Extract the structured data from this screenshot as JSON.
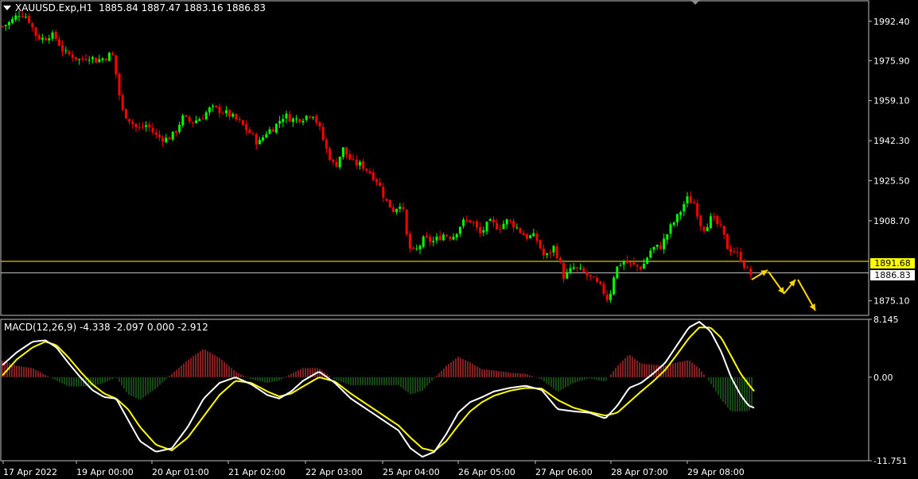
{
  "header": {
    "symbol": "XAUUSD.Exp,H1",
    "ohlc": "1885.84 1887.47 1883.16 1886.83"
  },
  "macd_label": "MACD(12,26,9) -4.338 -2.097 0.000 -2.912",
  "price_axis": {
    "ticks": [
      "1992.40",
      "1975.90",
      "1959.10",
      "1942.30",
      "1925.50",
      "1908.70",
      "1875.10"
    ],
    "tick_values": [
      1992.4,
      1975.9,
      1959.1,
      1942.3,
      1925.5,
      1908.7,
      1875.1
    ],
    "level_label": "1891.68",
    "bid_label": "1886.83"
  },
  "macd_axis": {
    "ticks": [
      "8.145",
      "0.00",
      "-11.751"
    ],
    "tick_values": [
      8.145,
      0.0,
      -11.751
    ]
  },
  "time_axis": {
    "labels": [
      "17 Apr 2022",
      "19 Apr 00:00",
      "20 Apr 01:00",
      "21 Apr 02:00",
      "22 Apr 03:00",
      "25 Apr 04:00",
      "26 Apr 05:00",
      "27 Apr 06:00",
      "28 Apr 07:00",
      "29 Apr 08:00"
    ]
  },
  "colors": {
    "background": "#000000",
    "bull": "#00ff00",
    "bear": "#ff0000",
    "level": "#ffff00",
    "bid": "#c0c0c0",
    "macd_main": "#ffffff",
    "macd_signal": "#ffff00",
    "hist_pos": "#ff4040",
    "hist_neg": "#2e8b2e",
    "arrows": "#ffd700"
  },
  "chart_data": [
    {
      "type": "candlestick",
      "symbol": "XAUUSD.Exp",
      "timeframe": "H1",
      "ylim": [
        1869.0,
        2001.0
      ],
      "level_line": 1891.68,
      "bid_line": 1886.83,
      "close_path": [
        [
          0,
          1990
        ],
        [
          12,
          1992
        ],
        [
          24,
          1996
        ],
        [
          34,
          1994
        ],
        [
          45,
          1986
        ],
        [
          54,
          1985
        ],
        [
          62,
          1987
        ],
        [
          70,
          1985
        ],
        [
          80,
          1979
        ],
        [
          90,
          1978
        ],
        [
          100,
          1976
        ],
        [
          110,
          1978
        ],
        [
          120,
          1976
        ],
        [
          130,
          1977
        ],
        [
          140,
          1979
        ],
        [
          146,
          1968
        ],
        [
          152,
          1955
        ],
        [
          160,
          1952
        ],
        [
          172,
          1947
        ],
        [
          184,
          1949
        ],
        [
          196,
          1944
        ],
        [
          208,
          1943
        ],
        [
          218,
          1945
        ],
        [
          228,
          1952
        ],
        [
          240,
          1950
        ],
        [
          252,
          1952
        ],
        [
          264,
          1956
        ],
        [
          276,
          1955
        ],
        [
          288,
          1953
        ],
        [
          300,
          1950
        ],
        [
          312,
          1946
        ],
        [
          324,
          1941
        ],
        [
          334,
          1946
        ],
        [
          344,
          1948
        ],
        [
          356,
          1953
        ],
        [
          368,
          1951
        ],
        [
          380,
          1952
        ],
        [
          392,
          1954
        ],
        [
          400,
          1948
        ],
        [
          410,
          1938
        ],
        [
          420,
          1931
        ],
        [
          430,
          1939
        ],
        [
          442,
          1933
        ],
        [
          454,
          1932
        ],
        [
          464,
          1929
        ],
        [
          474,
          1925
        ],
        [
          484,
          1917
        ],
        [
          494,
          1913
        ],
        [
          504,
          1917
        ],
        [
          512,
          1898
        ],
        [
          520,
          1895
        ],
        [
          532,
          1901
        ],
        [
          544,
          1900
        ],
        [
          556,
          1903
        ],
        [
          568,
          1902
        ],
        [
          580,
          1908
        ],
        [
          592,
          1909
        ],
        [
          602,
          1903
        ],
        [
          614,
          1908
        ],
        [
          626,
          1906
        ],
        [
          638,
          1909
        ],
        [
          648,
          1906
        ],
        [
          660,
          1902
        ],
        [
          672,
          1902
        ],
        [
          684,
          1893
        ],
        [
          696,
          1898
        ],
        [
          708,
          1885
        ],
        [
          720,
          1889
        ],
        [
          732,
          1887
        ],
        [
          744,
          1884
        ],
        [
          756,
          1880
        ],
        [
          764,
          1875
        ],
        [
          772,
          1888
        ],
        [
          782,
          1892
        ],
        [
          794,
          1890
        ],
        [
          806,
          1889
        ],
        [
          818,
          1897
        ],
        [
          830,
          1898
        ],
        [
          842,
          1906
        ],
        [
          852,
          1911
        ],
        [
          862,
          1918
        ],
        [
          872,
          1916
        ],
        [
          882,
          1905
        ],
        [
          894,
          1910
        ],
        [
          906,
          1905
        ],
        [
          914,
          1897
        ],
        [
          922,
          1896
        ],
        [
          930,
          1893
        ],
        [
          938,
          1888
        ],
        [
          946,
          1885
        ]
      ]
    },
    {
      "type": "line",
      "indicator": "MACD(12,26,9)",
      "ylim": [
        -11.751,
        8.145
      ],
      "series": [
        {
          "name": "MACD",
          "role": "main",
          "points": [
            [
              0,
              1.5
            ],
            [
              20,
              3.5
            ],
            [
              40,
              5.0
            ],
            [
              56,
              5.2
            ],
            [
              70,
              4.2
            ],
            [
              85,
              2.0
            ],
            [
              100,
              0.0
            ],
            [
              115,
              -1.8
            ],
            [
              130,
              -2.8
            ],
            [
              145,
              -3.0
            ],
            [
              160,
              -6.0
            ],
            [
              175,
              -9.0
            ],
            [
              195,
              -10.5
            ],
            [
              215,
              -10.0
            ],
            [
              235,
              -7.0
            ],
            [
              255,
              -3.0
            ],
            [
              275,
              -0.8
            ],
            [
              295,
              0.0
            ],
            [
              315,
              -1.0
            ],
            [
              335,
              -2.5
            ],
            [
              350,
              -3.0
            ],
            [
              365,
              -2.0
            ],
            [
              380,
              -0.5
            ],
            [
              400,
              0.8
            ],
            [
              420,
              -0.8
            ],
            [
              440,
              -3.0
            ],
            [
              460,
              -4.5
            ],
            [
              480,
              -6.0
            ],
            [
              500,
              -7.5
            ],
            [
              515,
              -10.0
            ],
            [
              530,
              -11.2
            ],
            [
              545,
              -10.5
            ],
            [
              560,
              -8.0
            ],
            [
              575,
              -5.0
            ],
            [
              590,
              -3.5
            ],
            [
              605,
              -2.8
            ],
            [
              620,
              -2.0
            ],
            [
              640,
              -1.5
            ],
            [
              660,
              -1.2
            ],
            [
              680,
              -1.8
            ],
            [
              700,
              -4.5
            ],
            [
              720,
              -4.8
            ],
            [
              740,
              -5.0
            ],
            [
              760,
              -5.8
            ],
            [
              775,
              -4.0
            ],
            [
              790,
              -1.5
            ],
            [
              805,
              -0.8
            ],
            [
              820,
              0.5
            ],
            [
              835,
              2.0
            ],
            [
              850,
              4.5
            ],
            [
              865,
              7.0
            ],
            [
              878,
              7.8
            ],
            [
              892,
              6.5
            ],
            [
              906,
              3.5
            ],
            [
              918,
              0.0
            ],
            [
              930,
              -2.5
            ],
            [
              940,
              -4.0
            ],
            [
              948,
              -4.338
            ]
          ]
        },
        {
          "name": "Signal",
          "role": "signal",
          "points": [
            [
              0,
              0.0
            ],
            [
              20,
              2.5
            ],
            [
              40,
              4.2
            ],
            [
              56,
              5.0
            ],
            [
              70,
              4.5
            ],
            [
              85,
              2.8
            ],
            [
              100,
              0.8
            ],
            [
              115,
              -1.0
            ],
            [
              130,
              -2.3
            ],
            [
              145,
              -3.0
            ],
            [
              160,
              -4.5
            ],
            [
              175,
              -7.0
            ],
            [
              195,
              -9.5
            ],
            [
              215,
              -10.3
            ],
            [
              235,
              -8.5
            ],
            [
              255,
              -5.5
            ],
            [
              275,
              -2.5
            ],
            [
              295,
              -0.5
            ],
            [
              315,
              -0.8
            ],
            [
              335,
              -2.0
            ],
            [
              350,
              -2.7
            ],
            [
              365,
              -2.3
            ],
            [
              380,
              -1.3
            ],
            [
              400,
              0.0
            ],
            [
              420,
              -0.6
            ],
            [
              440,
              -2.3
            ],
            [
              460,
              -3.8
            ],
            [
              480,
              -5.3
            ],
            [
              500,
              -6.8
            ],
            [
              515,
              -8.5
            ],
            [
              530,
              -10.0
            ],
            [
              545,
              -10.4
            ],
            [
              560,
              -9.0
            ],
            [
              575,
              -6.8
            ],
            [
              590,
              -4.8
            ],
            [
              605,
              -3.5
            ],
            [
              620,
              -2.6
            ],
            [
              640,
              -1.9
            ],
            [
              660,
              -1.5
            ],
            [
              680,
              -1.6
            ],
            [
              700,
              -3.2
            ],
            [
              720,
              -4.3
            ],
            [
              740,
              -4.9
            ],
            [
              760,
              -5.4
            ],
            [
              775,
              -5.0
            ],
            [
              790,
              -3.5
            ],
            [
              805,
              -2.0
            ],
            [
              820,
              -0.6
            ],
            [
              835,
              1.0
            ],
            [
              850,
              3.2
            ],
            [
              865,
              5.5
            ],
            [
              878,
              7.0
            ],
            [
              892,
              7.0
            ],
            [
              906,
              5.5
            ],
            [
              918,
              3.0
            ],
            [
              930,
              0.5
            ],
            [
              940,
              -1.0
            ],
            [
              948,
              -2.097
            ]
          ]
        }
      ]
    }
  ]
}
